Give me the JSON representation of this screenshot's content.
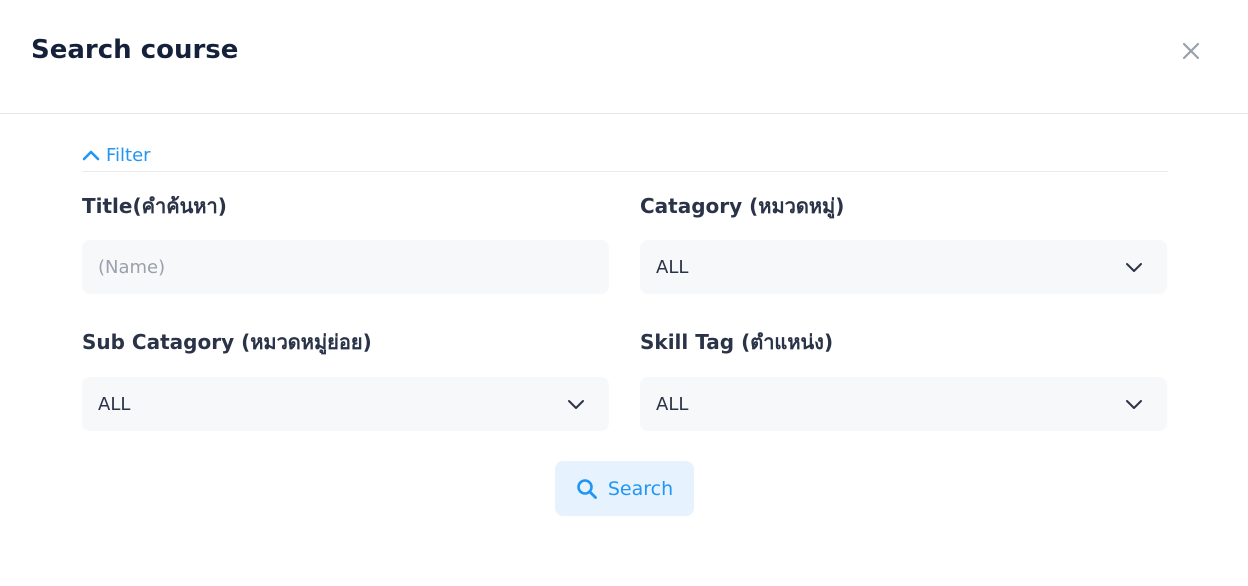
{
  "modal": {
    "title": "Search course"
  },
  "filter": {
    "toggle_label": "Filter"
  },
  "fields": {
    "title": {
      "label": "Title(คำค้นหา)",
      "placeholder": "(Name)",
      "value": ""
    },
    "category": {
      "label": "Catagory (หมวดหมู่)",
      "value": "ALL"
    },
    "sub_category": {
      "label": "Sub Catagory (หมวดหมู่ย่อย)",
      "value": "ALL"
    },
    "skill_tag": {
      "label": "Skill Tag (ตำแหน่ง)",
      "value": "ALL"
    }
  },
  "actions": {
    "search_label": "Search"
  },
  "colors": {
    "accent": "#2196f3",
    "title_text": "#15203a",
    "label_text": "#2a3347",
    "placeholder": "#9aa1ad",
    "field_bg": "#f7f8f9",
    "button_bg": "#e6f2fd"
  },
  "icons": {
    "close": "close-icon",
    "filter_toggle": "chevron-up-icon",
    "select": "chevron-down-icon",
    "search": "search-icon"
  }
}
